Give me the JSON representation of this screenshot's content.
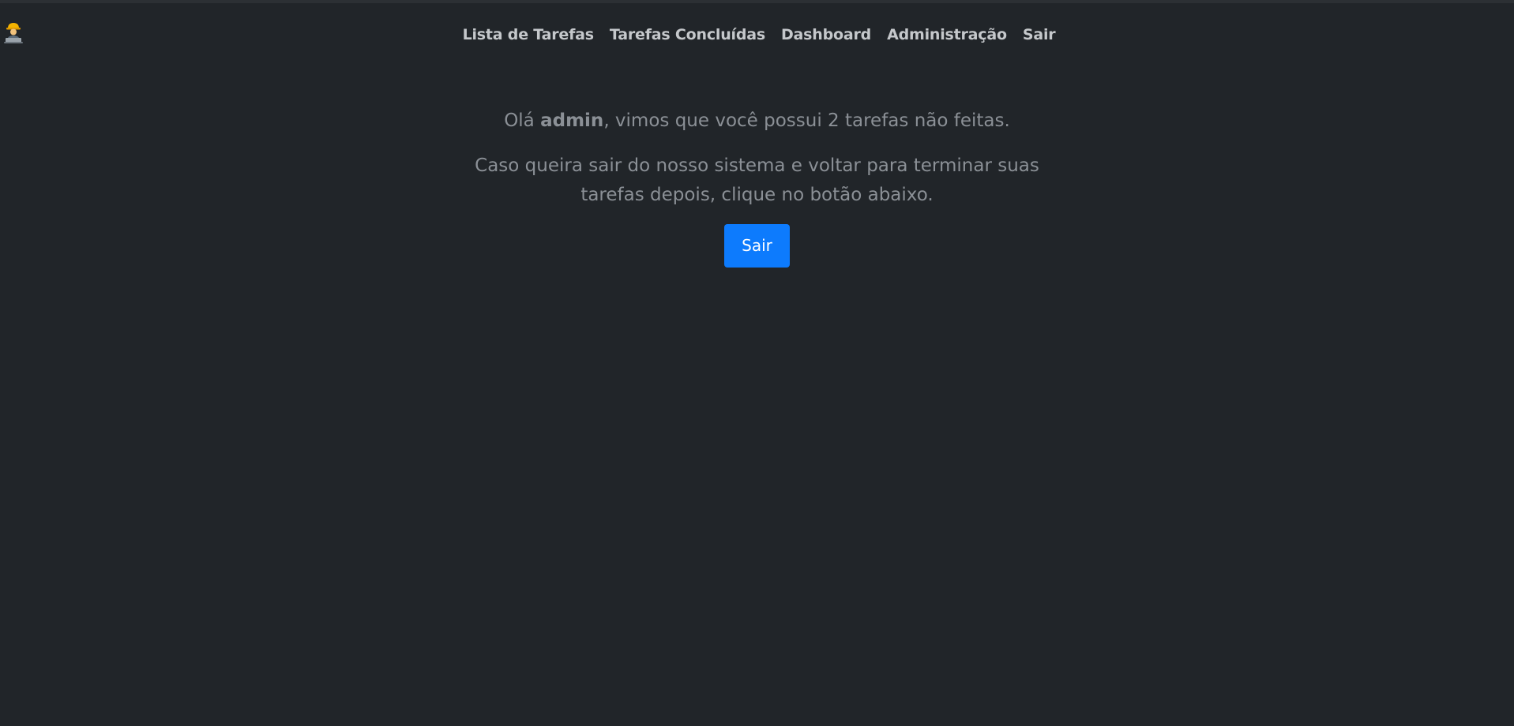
{
  "logo": {
    "icon": "worker-at-laptop-icon"
  },
  "nav": {
    "items": [
      {
        "label": "Lista de Tarefas"
      },
      {
        "label": "Tarefas Concluídas"
      },
      {
        "label": "Dashboard"
      },
      {
        "label": "Administração"
      },
      {
        "label": "Sair"
      }
    ]
  },
  "main": {
    "greeting_prefix": "Olá ",
    "username": "admin",
    "greeting_suffix": ", vimos que você possui 2 tarefas não feitas.",
    "info": "Caso queira sair do nosso sistema e voltar para terminar suas tarefas depois, clique no botão abaixo.",
    "button_label": "Sair"
  },
  "colors": {
    "background": "#212529",
    "nav_text": "#c5c8cb",
    "body_text": "#8b9096",
    "button": "#0d7bfd"
  }
}
